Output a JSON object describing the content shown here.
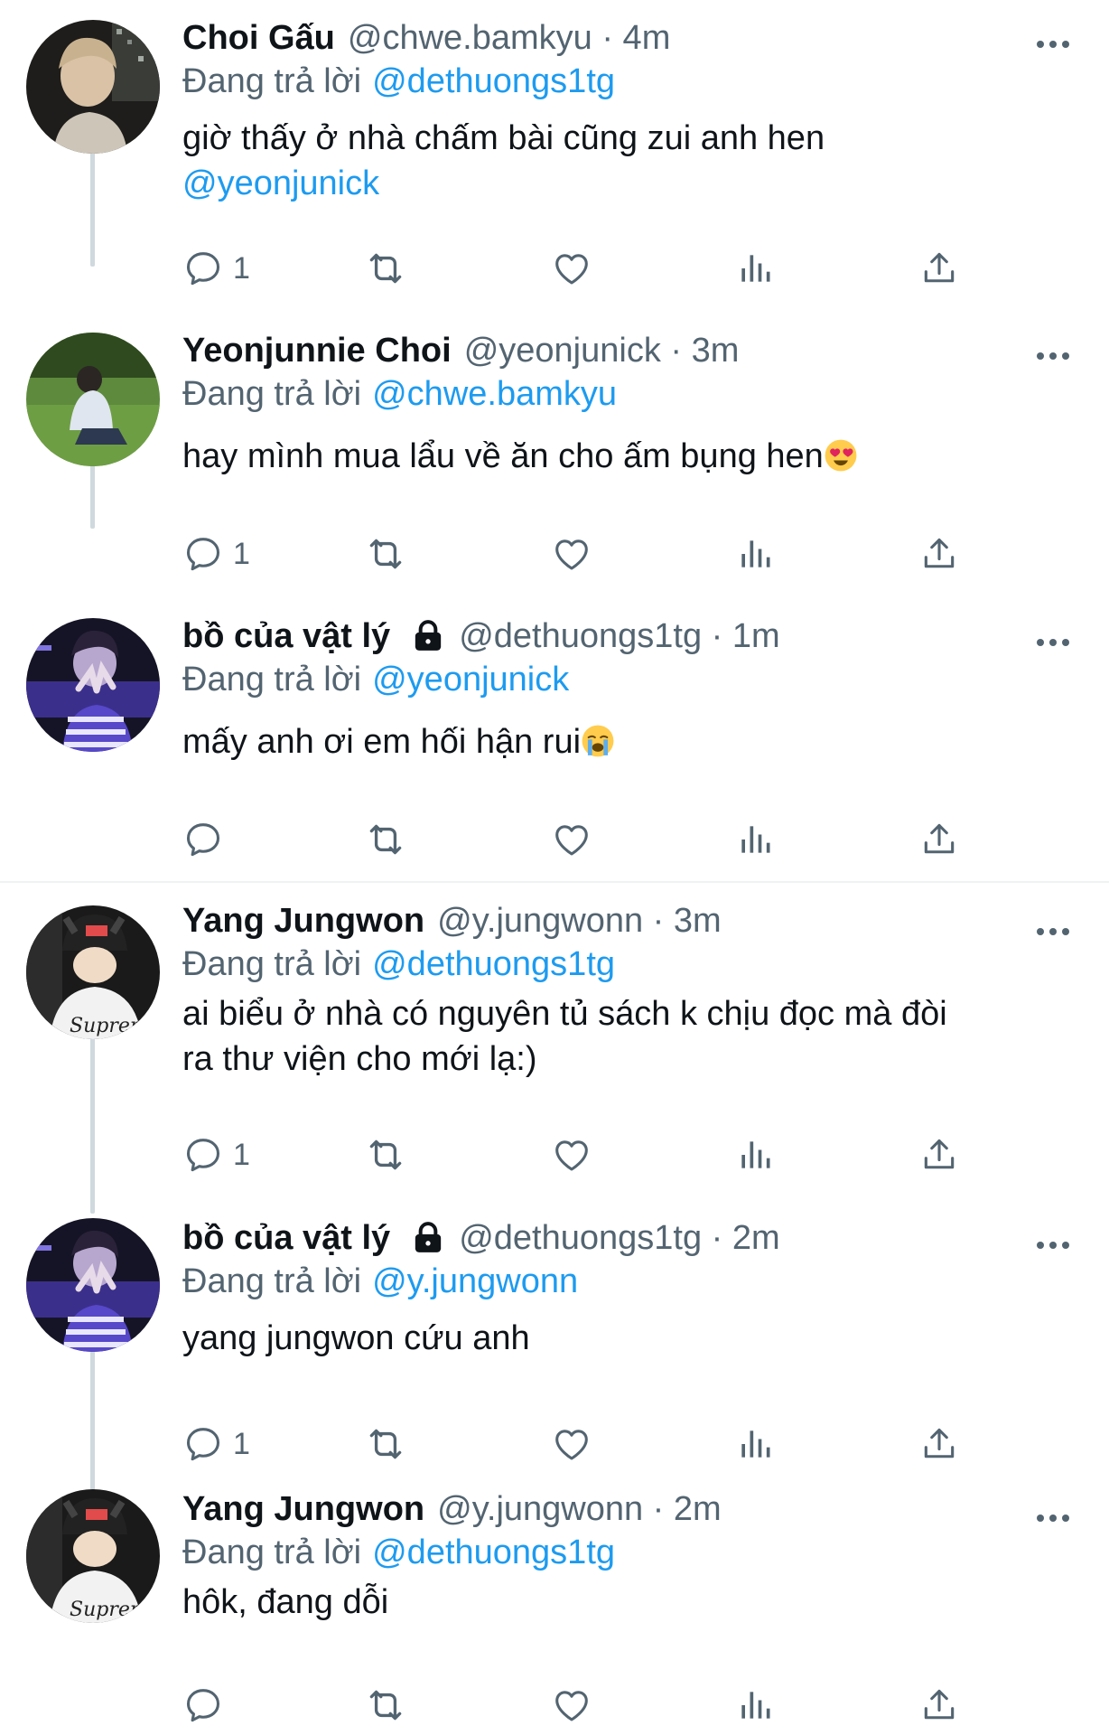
{
  "tweets": [
    {
      "display_name": "Choi Gấu",
      "handle_time": "@chwe.bamkyu · 4m",
      "reply_prefix": "Đang trả lời",
      "reply_to": "@dethuongs1tg",
      "text_line1": "giờ thấy ở nhà chấm bài cũng zui anh hen",
      "text_mention": "@yeonjunick",
      "reply_count": "1",
      "avatar": "night-city-avatar"
    },
    {
      "display_name": "Yeonjunnie Choi",
      "handle_time": "@yeonjunick · 3m",
      "reply_prefix": "Đang trả lời",
      "reply_to": "@chwe.bamkyu",
      "text": "hay mình mua lẩu về ăn cho ấm bụng hen",
      "emoji": "heart-eyes-emoji",
      "reply_count": "1",
      "avatar": "park-grass-avatar"
    },
    {
      "display_name": "bồ của vật lý",
      "locked": true,
      "handle_time": "@dethuongs1tg · 1m",
      "reply_prefix": "Đang trả lời",
      "reply_to": "@yeonjunick",
      "text": "mấy anh ơi em hối hận rui",
      "emoji": "crying-emoji",
      "reply_count": "",
      "avatar": "purple-stage-avatar"
    },
    {
      "display_name": "Yang Jungwon",
      "handle_time": "@y.jungwonn · 3m",
      "reply_prefix": "Đang trả lời",
      "reply_to": "@dethuongs1tg",
      "text_line1": "ai biểu ở nhà có nguyên tủ sách k chịu đọc mà đòi",
      "text_line2": "ra thư viện cho mới lạ:)",
      "reply_count": "1",
      "avatar": "beanie-avatar"
    },
    {
      "display_name": "bồ của vật lý",
      "locked": true,
      "handle_time": "@dethuongs1tg · 2m",
      "reply_prefix": "Đang trả lời",
      "reply_to": "@y.jungwonn",
      "text": "yang jungwon cứu anh",
      "reply_count": "1",
      "avatar": "purple-stage-avatar"
    },
    {
      "display_name": "Yang Jungwon",
      "handle_time": "@y.jungwonn · 2m",
      "reply_prefix": "Đang trả lời",
      "reply_to": "@dethuongs1tg",
      "text": "hôk, đang dỗi",
      "reply_count": "",
      "avatar": "beanie-avatar"
    }
  ],
  "colors": {
    "text": "#0f1419",
    "secondary": "#536471",
    "link": "#1d9bf0",
    "thread_line": "#cfd9de",
    "divider": "#eff3f4"
  },
  "icons": [
    "reply-icon",
    "retweet-icon",
    "like-icon",
    "views-icon",
    "share-icon",
    "more-icon",
    "lock-icon"
  ]
}
